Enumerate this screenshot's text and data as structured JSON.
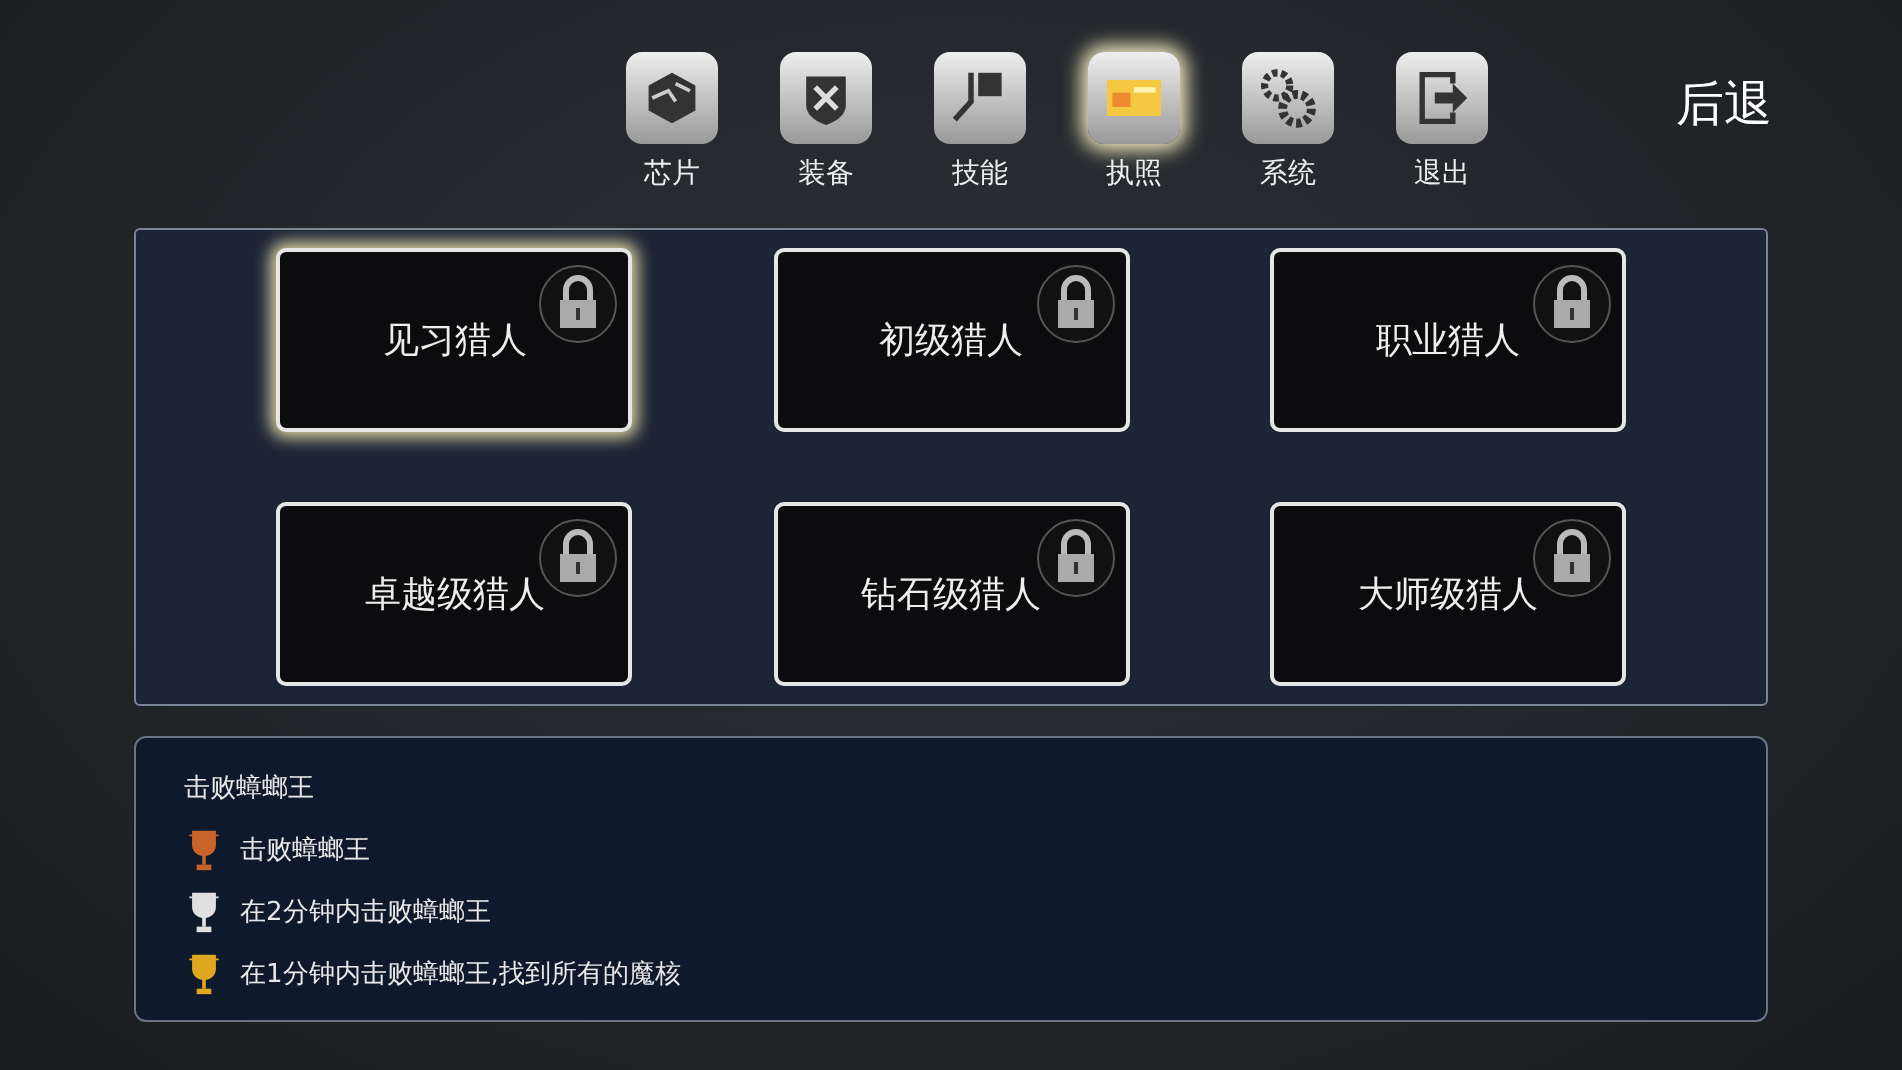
{
  "nav": [
    {
      "label": "芯片",
      "kind": "chip",
      "selected": false
    },
    {
      "label": "装备",
      "kind": "shield",
      "selected": false
    },
    {
      "label": "技能",
      "kind": "skill",
      "selected": false
    },
    {
      "label": "执照",
      "kind": "license",
      "selected": true
    },
    {
      "label": "系统",
      "kind": "gears",
      "selected": false
    },
    {
      "label": "退出",
      "kind": "exit",
      "selected": false
    }
  ],
  "back": "后退",
  "licenses": [
    {
      "label": "见习猎人",
      "selected": true,
      "locked": true
    },
    {
      "label": "初级猎人",
      "selected": false,
      "locked": true
    },
    {
      "label": "职业猎人",
      "selected": false,
      "locked": true
    },
    {
      "label": "卓越级猎人",
      "selected": false,
      "locked": true
    },
    {
      "label": "钻石级猎人",
      "selected": false,
      "locked": true
    },
    {
      "label": "大师级猎人",
      "selected": false,
      "locked": true
    }
  ],
  "details": {
    "title": "击败蟑螂王",
    "goals": [
      {
        "text": "击败蟑螂王",
        "color": "#c8642a"
      },
      {
        "text": "在2分钟内击败蟑螂王",
        "color": "#e0e0e0"
      },
      {
        "text": "在1分钟内击败蟑螂王,找到所有的魔核",
        "color": "#e0a820"
      }
    ]
  }
}
